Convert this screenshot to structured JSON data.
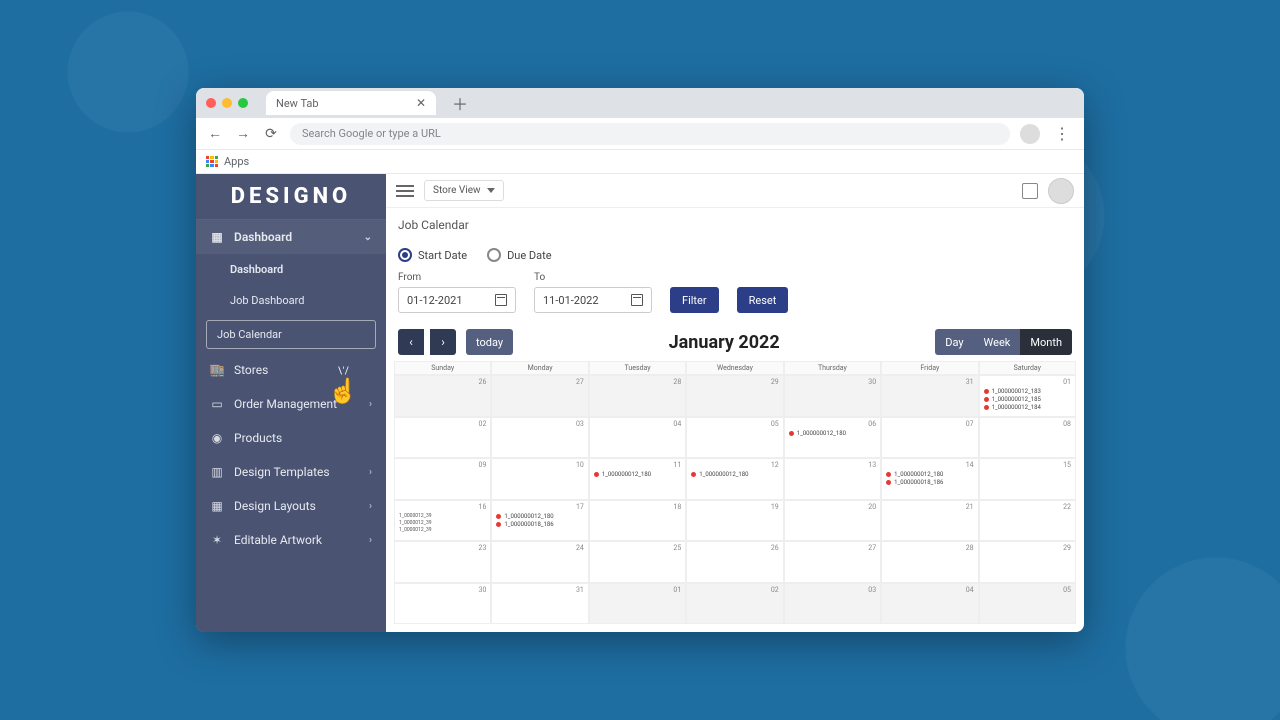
{
  "browser": {
    "tab_title": "New Tab",
    "omnibox_placeholder": "Search Google or type a URL",
    "bookmark_apps": "Apps"
  },
  "brand": "DESIGNO",
  "storeview_label": "Store View",
  "sidebar": {
    "dashboard": "Dashboard",
    "sub_dashboard": "Dashboard",
    "sub_job_dashboard": "Job Dashboard",
    "sub_job_calendar": "Job Calendar",
    "stores": "Stores",
    "order_mgmt": "Order Management",
    "products": "Products",
    "design_templates": "Design Templates",
    "design_layouts": "Design Layouts",
    "editable_artwork": "Editable Artwork"
  },
  "page": {
    "title": "Job Calendar",
    "radio_start": "Start Date",
    "radio_due": "Due Date",
    "from_label": "From",
    "to_label": "To",
    "from_value": "01-12-2021",
    "to_value": "11-01-2022",
    "filter": "Filter",
    "reset": "Reset",
    "today": "today",
    "cal_title": "January 2022",
    "view_day": "Day",
    "view_week": "Week",
    "view_month": "Month",
    "dow": [
      "Sunday",
      "Monday",
      "Tuesday",
      "Wednesday",
      "Thursday",
      "Friday",
      "Saturday"
    ]
  },
  "events": {
    "sat1_a": "1_000000012_183",
    "sat1_b": "1_000000012_185",
    "sat1_c": "1_000000012_184",
    "thu6": "1_000000012_180",
    "tue11": "1_000000012_180",
    "wed12": "1_000000012_180",
    "fri14_a": "1_000000012_180",
    "fri14_b": "1_000000018_186",
    "mon17_a": "1_000000012_180",
    "mon17_b": "1_000000018_186",
    "sun16_a": "1_0000012_39",
    "sun16_b": "1_0000012_39",
    "sun16_c": "1_0000012_39"
  },
  "days": {
    "r1": [
      "26",
      "27",
      "28",
      "29",
      "30",
      "31",
      "01"
    ],
    "r2": [
      "02",
      "03",
      "04",
      "05",
      "06",
      "07",
      "08"
    ],
    "r3": [
      "09",
      "10",
      "11",
      "12",
      "13",
      "14",
      "15"
    ],
    "r4": [
      "16",
      "17",
      "18",
      "19",
      "20",
      "21",
      "22"
    ],
    "r5": [
      "23",
      "24",
      "25",
      "26",
      "27",
      "28",
      "29"
    ],
    "r6": [
      "30",
      "31",
      "01",
      "02",
      "03",
      "04",
      "05"
    ]
  }
}
